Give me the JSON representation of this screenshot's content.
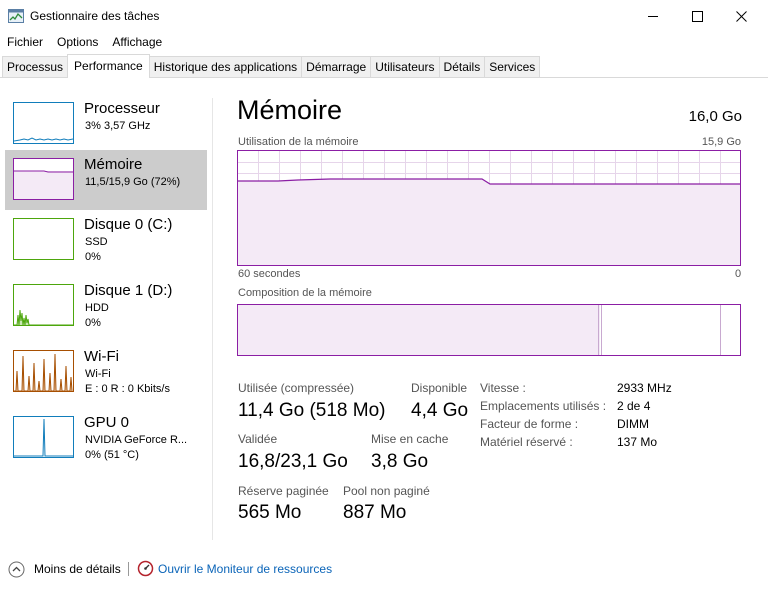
{
  "window": {
    "title": "Gestionnaire des tâches"
  },
  "menu": [
    "Fichier",
    "Options",
    "Affichage"
  ],
  "tabs": [
    {
      "label": "Processus",
      "active": false
    },
    {
      "label": "Performance",
      "active": true
    },
    {
      "label": "Historique des applications",
      "active": false
    },
    {
      "label": "Démarrage",
      "active": false
    },
    {
      "label": "Utilisateurs",
      "active": false
    },
    {
      "label": "Détails",
      "active": false
    },
    {
      "label": "Services",
      "active": false
    }
  ],
  "sidebar": {
    "items": [
      {
        "title": "Processeur",
        "line1": "3% 3,57 GHz",
        "line2": "",
        "color": "#117dbb",
        "selected": false
      },
      {
        "title": "Mémoire",
        "line1": "11,5/15,9 Go (72%)",
        "line2": "",
        "color": "#8b1ea4",
        "selected": true
      },
      {
        "title": "Disque 0 (C:)",
        "line1": "SSD",
        "line2": "0%",
        "color": "#4da60c",
        "selected": false
      },
      {
        "title": "Disque 1 (D:)",
        "line1": "HDD",
        "line2": "0%",
        "color": "#4da60c",
        "selected": false
      },
      {
        "title": "Wi-Fi",
        "line1": "Wi-Fi",
        "line2": "E : 0 R : 0 Kbits/s",
        "color": "#a74f01",
        "selected": false
      },
      {
        "title": "GPU 0",
        "line1": "NVIDIA GeForce R...",
        "line2": "0% (51 °C)",
        "color": "#117dbb",
        "selected": false
      }
    ]
  },
  "main": {
    "title": "Mémoire",
    "total": "16,0 Go",
    "usage_label": "Utilisation de la mémoire",
    "usage_max": "15,9 Go",
    "time_left": "60 secondes",
    "time_right": "0",
    "composition_label": "Composition de la mémoire",
    "usage_level": 0.72,
    "stats": {
      "used_label": "Utilisée (compressée)",
      "used_value": "11,4 Go (518 Mo)",
      "available_label": "Disponible",
      "available_value": "4,4 Go",
      "committed_label": "Validée",
      "committed_value": "16,8/23,1 Go",
      "cached_label": "Mise en cache",
      "cached_value": "3,8 Go",
      "paged_label": "Réserve paginée",
      "paged_value": "565 Mo",
      "nonpaged_label": "Pool non paginé",
      "nonpaged_value": "887 Mo"
    },
    "info": [
      {
        "label": "Vitesse :",
        "value": "2933 MHz"
      },
      {
        "label": "Emplacements utilisés :",
        "value": "2 de 4"
      },
      {
        "label": "Facteur de forme :",
        "value": "DIMM"
      },
      {
        "label": "Matériel réservé :",
        "value": "137 Mo"
      }
    ]
  },
  "footer": {
    "fewer_details": "Moins de détails",
    "open_monitor": "Ouvrir le Moniteur de ressources"
  },
  "colors": {
    "memory": "#8b1ea4",
    "cpu": "#117dbb",
    "disk": "#4da60c",
    "wifi": "#a74f01",
    "link": "#0a64b8"
  }
}
